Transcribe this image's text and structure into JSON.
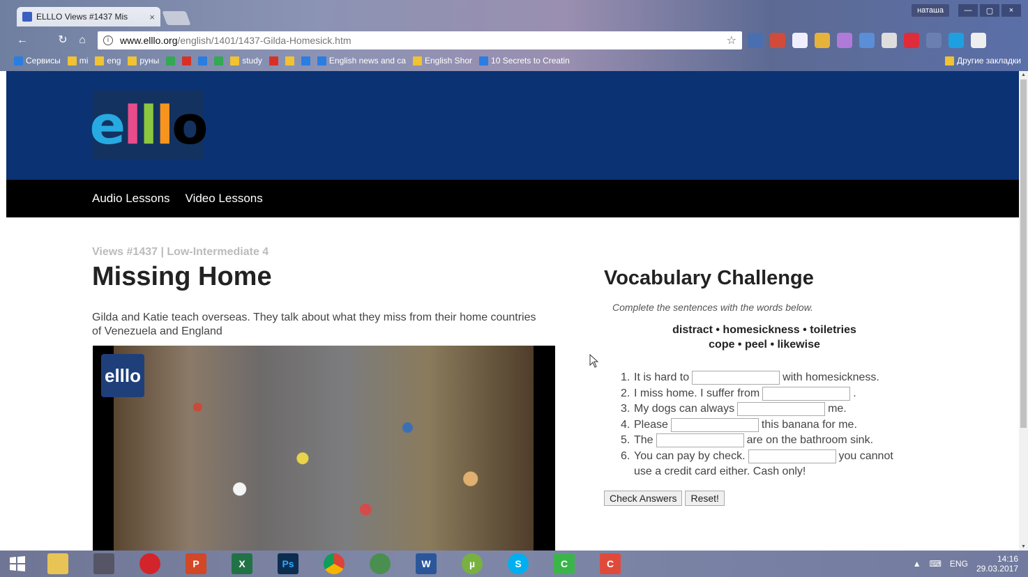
{
  "browser": {
    "tab_title": "ELLLO Views #1437 Mis",
    "tab_close": "×",
    "user": "наташа",
    "win_minimize": "—",
    "win_maximize": "▢",
    "win_close": "×",
    "url_host": "www.elllo.org",
    "url_path": "/english/1401/1437-Gilda-Homesick.htm",
    "bookmarks": [
      "Сервисы",
      "mi",
      "eng",
      "руны",
      "study",
      "English news and ca",
      "English Shor",
      "10 Secrets to Creatin"
    ],
    "bookmarks_right": "Другие закладки"
  },
  "site": {
    "logo_letters": [
      "e",
      "l",
      "l",
      "l",
      "o"
    ],
    "nav": [
      "Audio Lessons",
      "Video Lessons"
    ]
  },
  "lesson": {
    "breadcrumb": "Views #1437 | Low-Intermediate 4",
    "title": "Missing Home",
    "intro": "Gilda and Katie teach overseas. They talk about what they miss from their home countries of Venezuela and England",
    "video_logo": "elllo"
  },
  "vocab": {
    "title": "Vocabulary Challenge",
    "instructions": "Complete the sentences with the words below.",
    "words_line1": "distract • homesickness • toiletries",
    "words_line2": "cope • peel • likewise",
    "items": [
      {
        "num": "1.",
        "before": "It is hard to",
        "after": "with homesickness."
      },
      {
        "num": "2.",
        "before": "I miss home. I suffer from",
        "after": "."
      },
      {
        "num": "3.",
        "before": "My dogs can always",
        "after": "me."
      },
      {
        "num": "4.",
        "before": "Please",
        "after": "this banana for me."
      },
      {
        "num": "5.",
        "before": "The",
        "after": "are on the bathroom sink."
      },
      {
        "num": "6.",
        "before": "You can pay by check.",
        "after": "you cannot",
        "cont": "use a credit card either. Cash only!"
      }
    ],
    "check_label": "Check Answers",
    "reset_label": "Reset!"
  },
  "taskbar": {
    "lang": "ENG",
    "time": "14:16",
    "date": "29.03.2017",
    "apps": [
      "File Explorer",
      "Network",
      "Opera",
      "PowerPoint",
      "Excel",
      "Photoshop",
      "Chrome",
      "Globe",
      "Word",
      "uTorrent",
      "Skype",
      "Camtasia",
      "Camtasia Recorder"
    ]
  },
  "colors": {
    "header_bg": "#0b3272",
    "nav_bg": "#000000"
  }
}
